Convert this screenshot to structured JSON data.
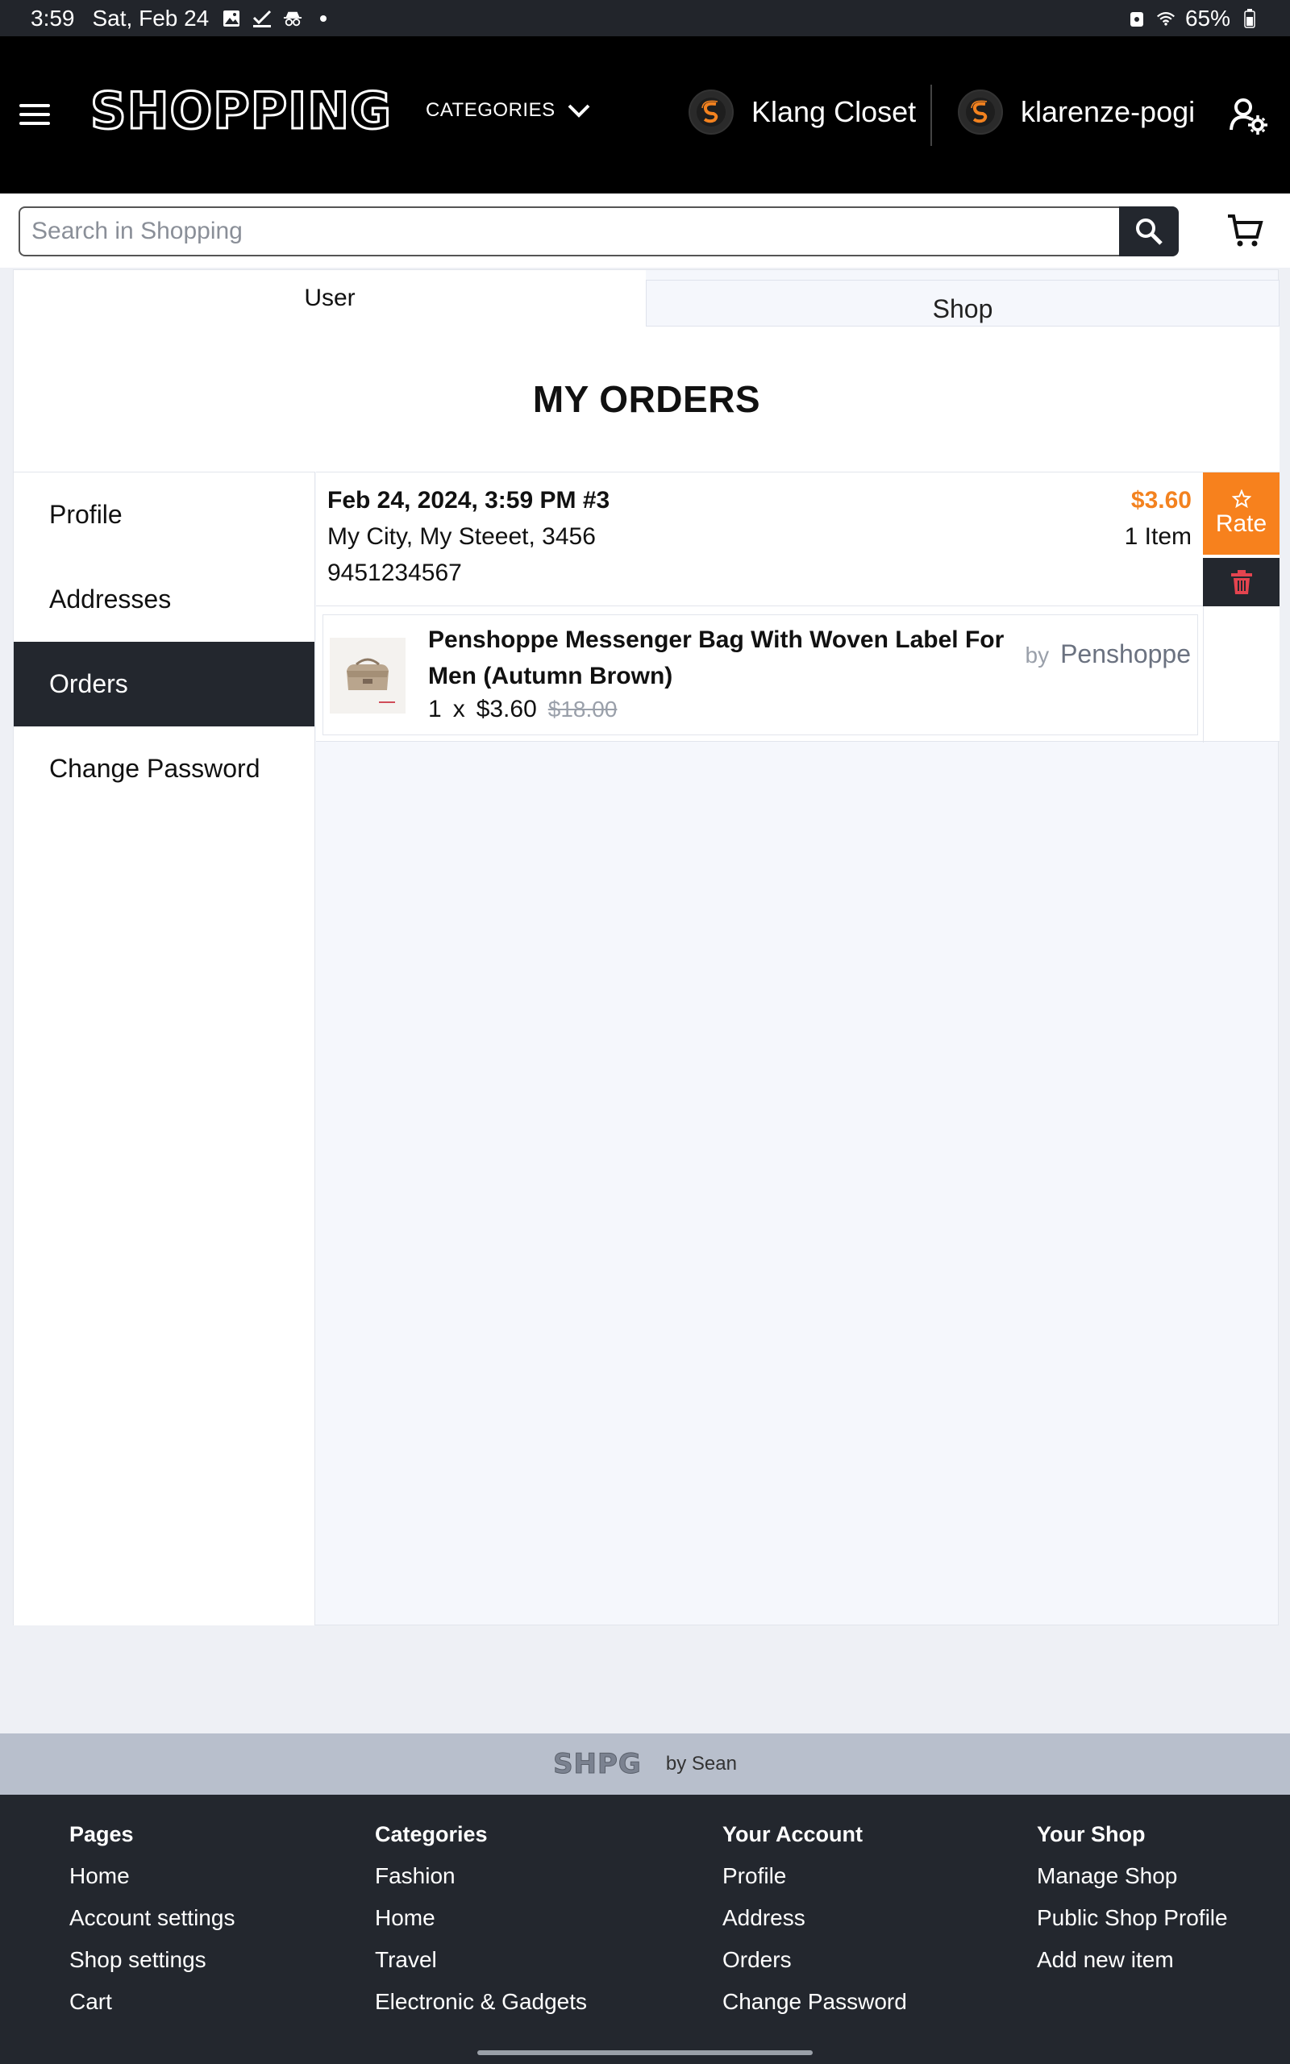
{
  "status_bar": {
    "time": "3:59",
    "date": "Sat, Feb 24",
    "battery": "65%"
  },
  "header": {
    "logo": "SHOPPING",
    "categories_label": "CATEGORIES",
    "shop_name": "Klang Closet",
    "username": "klarenze-pogi"
  },
  "search": {
    "placeholder": "Search in Shopping",
    "value": ""
  },
  "tabs": [
    {
      "label": "User",
      "active": true
    },
    {
      "label": "Shop",
      "active": false
    }
  ],
  "page_title": "MY ORDERS",
  "sidenav": {
    "items": [
      {
        "label": "Profile",
        "active": false
      },
      {
        "label": "Addresses",
        "active": false
      },
      {
        "label": "Orders",
        "active": true
      },
      {
        "label": "Change Password",
        "active": false
      }
    ]
  },
  "order": {
    "date": "Feb 24, 2024, 3:59 PM #3",
    "address": "My City, My Steeet, 3456",
    "phone": "9451234567",
    "total": "$3.60",
    "item_count": "1 Item",
    "rate_label": "Rate",
    "item": {
      "name": "Penshoppe Messenger Bag With Woven Label For Men (Autumn Brown)",
      "quantity": "1",
      "times": "x",
      "price": "$3.60",
      "original_price": "$18.00",
      "by": "by",
      "seller": "Penshoppe"
    }
  },
  "brand_bar": {
    "logo": "SHPG",
    "by": "by Sean"
  },
  "footer": {
    "columns": [
      {
        "title": "Pages",
        "links": [
          "Home",
          "Account settings",
          "Shop settings",
          "Cart"
        ]
      },
      {
        "title": "Categories",
        "links": [
          "Fashion",
          "Home",
          "Travel",
          "Electronic & Gadgets"
        ]
      },
      {
        "title": "Your Account",
        "links": [
          "Profile",
          "Address",
          "Orders",
          "Change Password"
        ]
      },
      {
        "title": "Your Shop",
        "links": [
          "Manage Shop",
          "Public Shop Profile",
          "Add new item"
        ]
      }
    ]
  },
  "colors": {
    "accent": "#f7811d",
    "dark": "#23272e",
    "appbar": "#000000"
  }
}
